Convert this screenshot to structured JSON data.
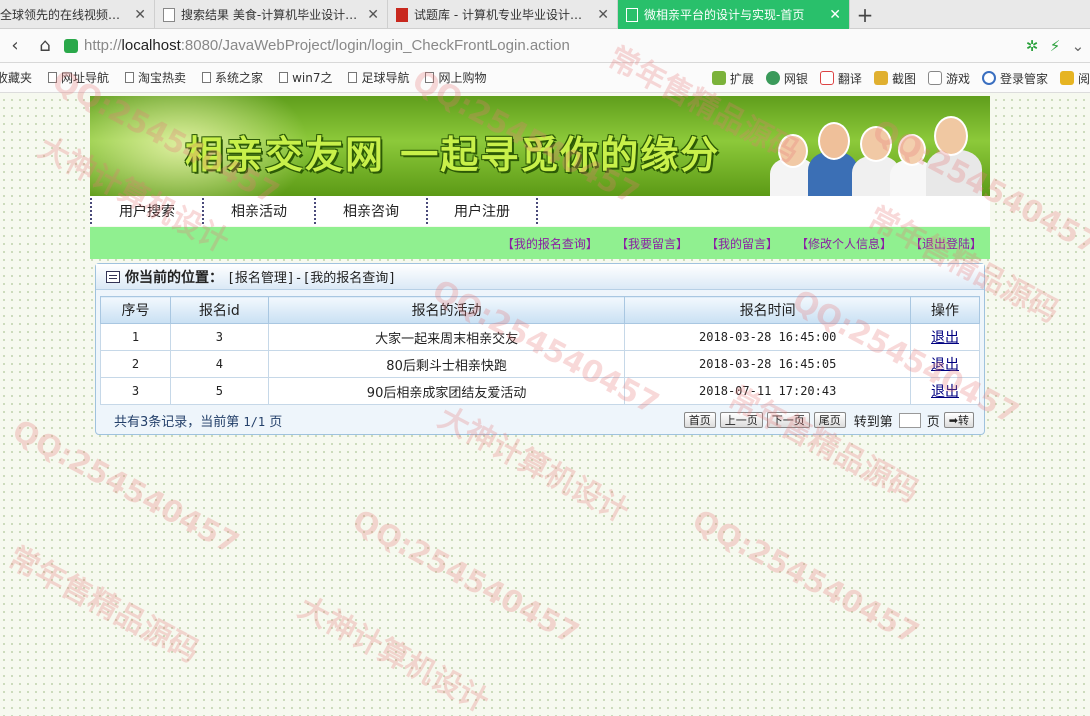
{
  "browser": {
    "tabs": [
      {
        "title": "全球领先的在线视频网站"
      },
      {
        "title": "搜索结果 美食-计算机毕业设计源码"
      },
      {
        "title": "试题库 - 计算机专业毕业设计源码"
      },
      {
        "title": "微相亲平台的设计与实现-首页",
        "active": true
      }
    ],
    "url_scheme": "http://",
    "url_host": "localhost",
    "url_rest": ":8080/JavaWebProject/login/login_CheckFrontLogin.action",
    "bookmarks": [
      "收藏夹",
      "网址导航",
      "淘宝热卖",
      "系统之家",
      "win7之",
      "足球导航",
      "网上购物"
    ],
    "toolbar_right": [
      "扩展",
      "网银",
      "翻译",
      "截图",
      "游戏",
      "登录管家",
      "阅"
    ]
  },
  "site": {
    "banner_title": "相亲交友网 一起寻觅你的缘分",
    "nav": [
      "用户搜索",
      "相亲活动",
      "相亲咨询",
      "用户注册"
    ],
    "subnav": [
      "【我的报名查询】",
      "【我要留言】",
      "【我的留言】",
      "【修改个人信息】",
      "【退出登陆】"
    ]
  },
  "panel": {
    "location_label": "你当前的位置：",
    "location_path": "[报名管理]-[我的报名查询]"
  },
  "table": {
    "headers": [
      "序号",
      "报名id",
      "报名的活动",
      "报名时间",
      "操作"
    ],
    "rows": [
      {
        "no": "1",
        "id": "3",
        "activity": "大家一起来周末相亲交友",
        "time": "2018-03-28 16:45:00",
        "action": "退出"
      },
      {
        "no": "2",
        "id": "4",
        "activity": "80后剩斗士相亲快跑",
        "time": "2018-03-28 16:45:05",
        "action": "退出"
      },
      {
        "no": "3",
        "id": "5",
        "activity": "90后相亲成家团结友爱活动",
        "time": "2018-07-11 17:20:43",
        "action": "退出"
      }
    ]
  },
  "pager": {
    "info_prefix": "共有3条记录，当前第 ",
    "info_page": "1/1",
    "info_suffix": " 页",
    "buttons": [
      "首页",
      "上一页",
      "下一页",
      "尾页"
    ],
    "jump_label": "转到第",
    "jump_unit": "页",
    "go_label": "➡转"
  },
  "watermarks": [
    "QQ:254540457",
    "大神计算机设计",
    "常年售精品源码"
  ]
}
